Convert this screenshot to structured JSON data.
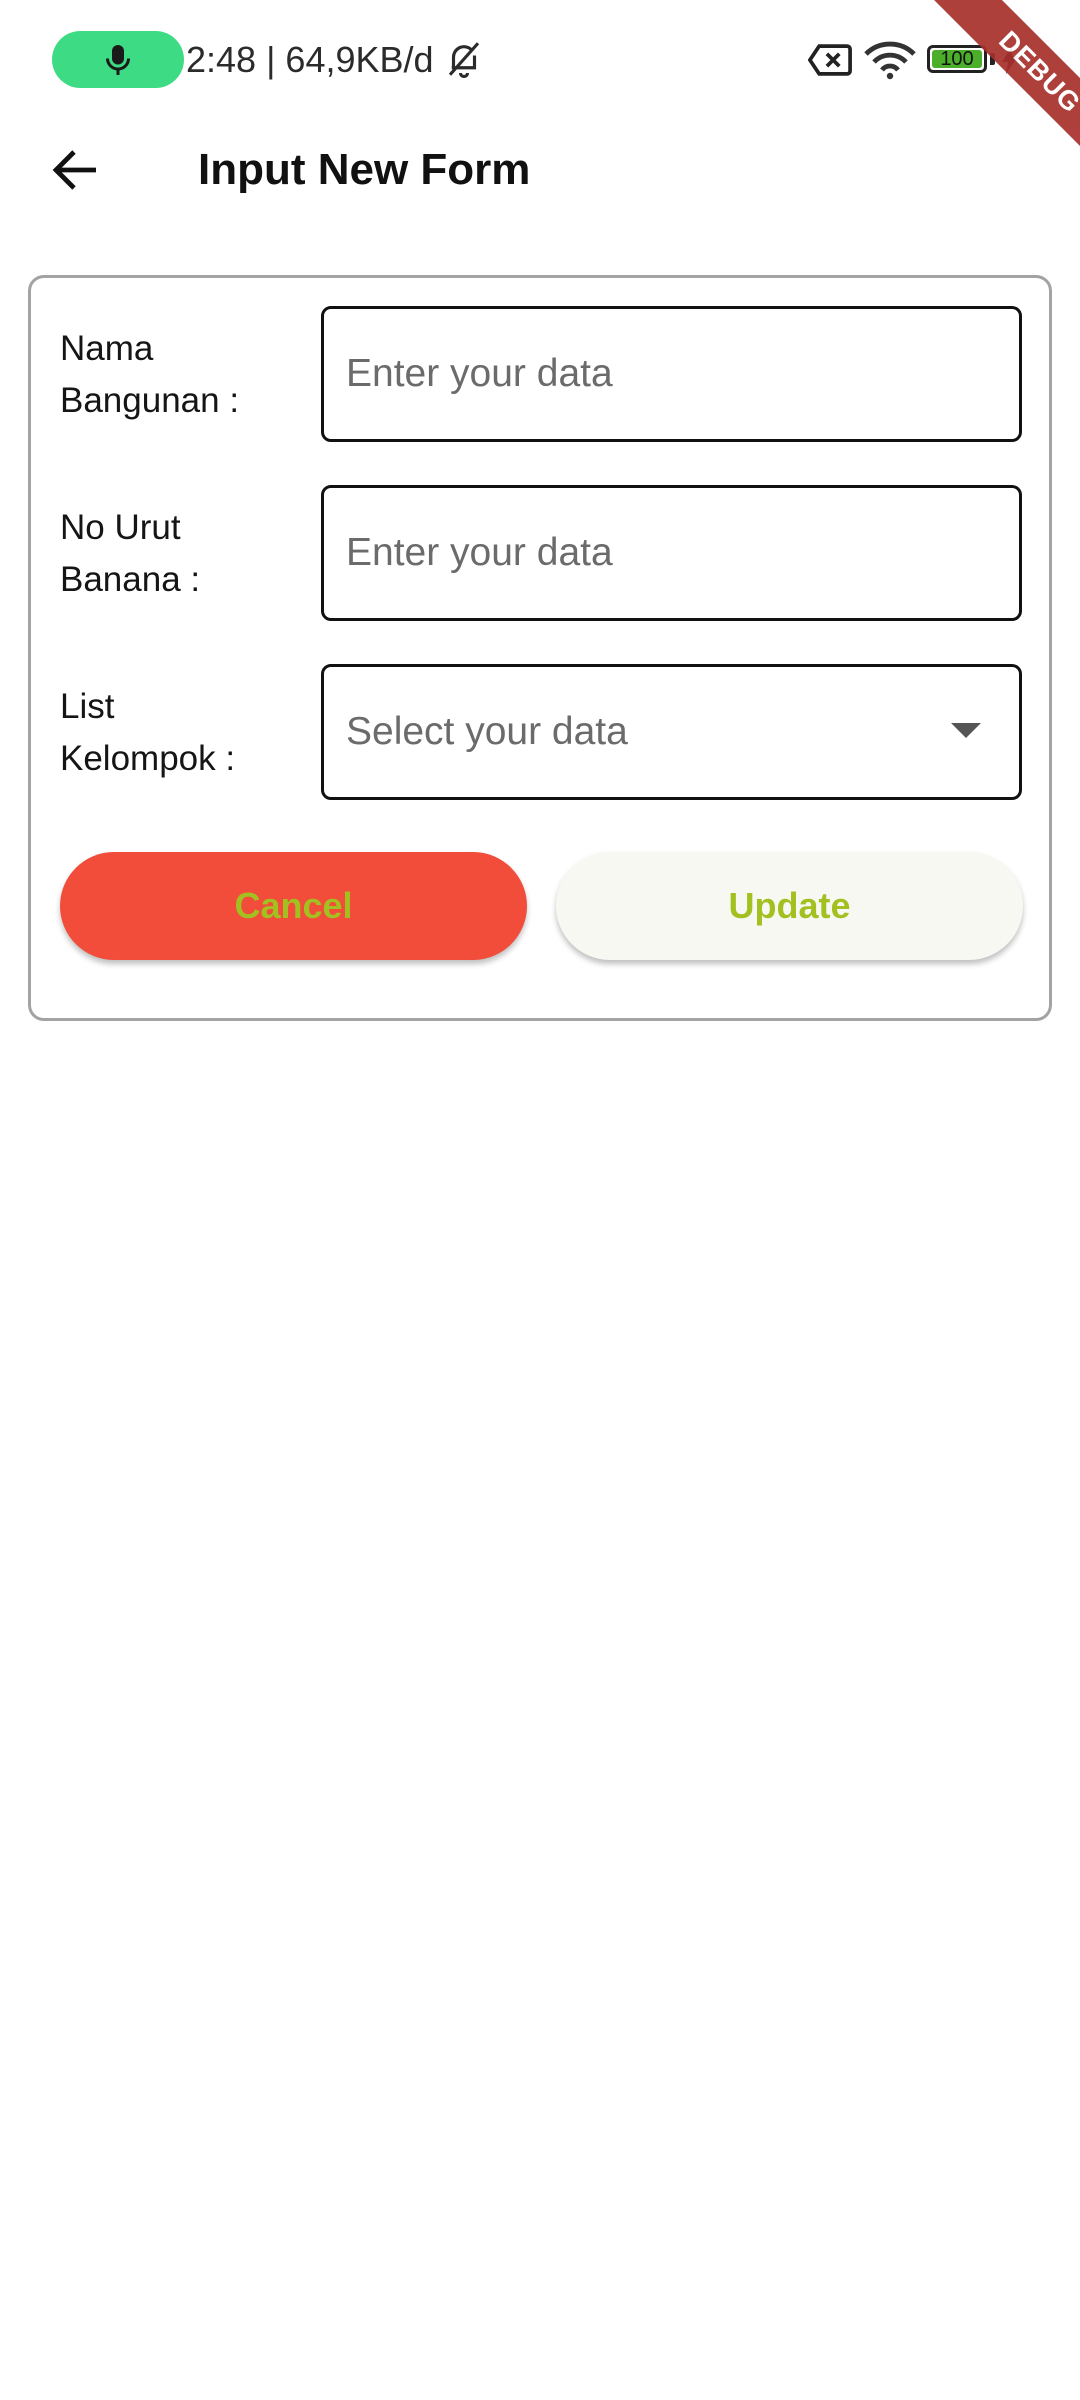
{
  "status_bar": {
    "time_and_speed": "2:48 | 64,9KB/d",
    "battery_level": "100",
    "mic_color": "#3ddc84",
    "icons": [
      "mic-icon",
      "bell-off-icon",
      "sim-off-icon",
      "wifi-icon",
      "battery-icon",
      "charging-icon"
    ]
  },
  "debug_banner": "DEBUG",
  "app_bar": {
    "title": "Input New Form",
    "back_icon": "arrow-left-icon"
  },
  "form": {
    "fields": [
      {
        "label_line1": "Nama",
        "label_line2": "Bangunan :",
        "placeholder": "Enter your data",
        "value": ""
      },
      {
        "label_line1": "No Urut",
        "label_line2": "Banana :",
        "placeholder": "Enter your data",
        "value": ""
      },
      {
        "label_line1": "List",
        "label_line2": "Kelompok :",
        "placeholder": "Select your data",
        "type": "dropdown"
      }
    ],
    "cancel_label": "Cancel",
    "update_label": "Update"
  },
  "colors": {
    "cancel_bg": "#f24c3a",
    "update_bg": "#f8f8f2",
    "button_text": "#a3c021",
    "card_border": "#a3a3a3"
  }
}
